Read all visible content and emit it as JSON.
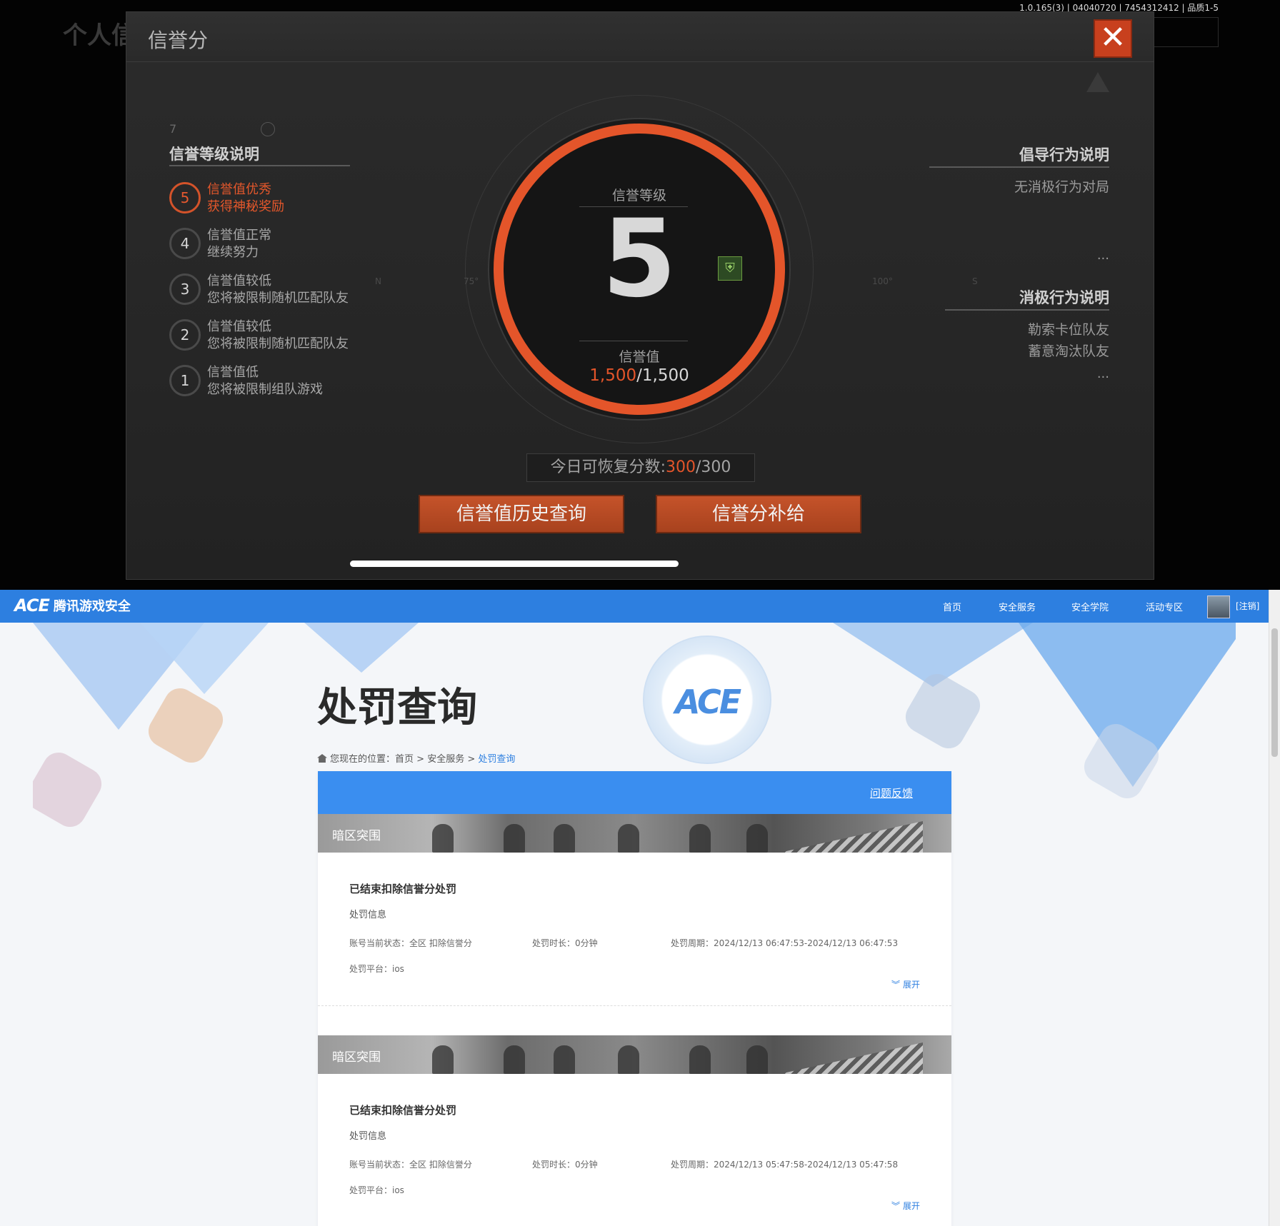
{
  "game": {
    "version_text": "1.0.165(3) | 04040720 | 7454312412 | 品质1-5",
    "bg_title": "个人信",
    "modal_title": "信誉分",
    "close_glyph": "✕",
    "level_section": {
      "title": "信誉等级说明",
      "corner_number": "7",
      "items": [
        {
          "level": "5",
          "line1": "信誉值优秀",
          "line2": "获得神秘奖励",
          "active": true
        },
        {
          "level": "4",
          "line1": "信誉值正常",
          "line2": "继续努力",
          "active": false
        },
        {
          "level": "3",
          "line1": "信誉值较低",
          "line2": "您将被限制随机匹配队友",
          "active": false
        },
        {
          "level": "2",
          "line1": "信誉值较低",
          "line2": "您将被限制随机匹配队友",
          "active": false
        },
        {
          "level": "1",
          "line1": "信誉值低",
          "line2": "您将被限制组队游戏",
          "active": false
        }
      ]
    },
    "ring": {
      "level_label": "信誉等级",
      "level": "5",
      "value_label": "信誉值",
      "value_current": "1,500",
      "value_sep_max": "/1,500"
    },
    "compass_marks": [
      "N",
      "75°",
      "100°",
      "S"
    ],
    "guide_section": {
      "title": "倡导行为说明",
      "item": "无消极行为对局",
      "more": "..."
    },
    "negative_section": {
      "title": "消极行为说明",
      "items": [
        "勒索卡位队友",
        "蓄意淘汰队友"
      ],
      "more": "..."
    },
    "recover": {
      "prefix": "今日可恢复分数:",
      "current": "300",
      "suffix": "/300"
    },
    "buttons": {
      "history": "信誉值历史查询",
      "supply": "信誉分补给"
    },
    "colors": {
      "accent": "#e4552a",
      "panel": "#262626"
    }
  },
  "web": {
    "logo_mark": "ACE",
    "brand": "腾讯游戏安全",
    "nav": [
      "首页",
      "安全服务",
      "安全学院",
      "活动专区"
    ],
    "logout": "[注销]",
    "page_title": "处罚查询",
    "breadcrumb": {
      "prefix": "您现在的位置：",
      "home": "首页",
      "sep": " > ",
      "service": "安全服务",
      "current": "处罚查询"
    },
    "feedback": "问题反馈",
    "records": [
      {
        "game": "暗区突围",
        "status": "已结束扣除信誉分处罚",
        "info_label": "处罚信息",
        "account_state": "账号当前状态：全区 扣除信誉分",
        "duration": "处罚时长：0分钟",
        "period": "处罚周期：2024/12/13 06:47:53-2024/12/13 06:47:53",
        "platform": "处罚平台：ios",
        "expand": "展开"
      },
      {
        "game": "暗区突围",
        "status": "已结束扣除信誉分处罚",
        "info_label": "处罚信息",
        "account_state": "账号当前状态：全区 扣除信誉分",
        "duration": "处罚时长：0分钟",
        "period": "处罚周期：2024/12/13 05:47:58-2024/12/13 05:47:58",
        "platform": "处罚平台：ios",
        "expand": "展开"
      }
    ],
    "colors": {
      "nav": "#2d7fe0",
      "card_head": "#3a8ef0"
    }
  }
}
